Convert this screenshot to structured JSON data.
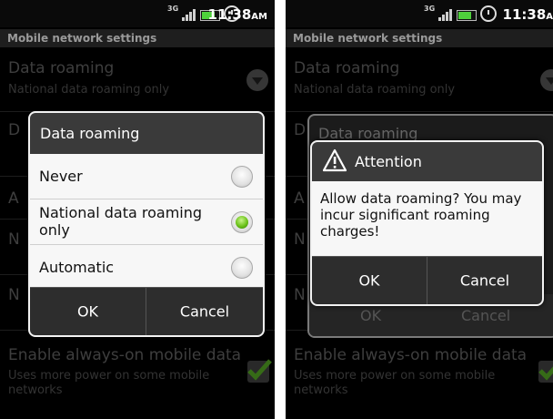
{
  "status_bar": {
    "network": "3G",
    "time": "11:38",
    "ampm": "AM"
  },
  "header": "Mobile network settings",
  "settings": {
    "data_roaming": {
      "title": "Data roaming",
      "summary": "National data roaming only"
    },
    "always_on": {
      "title": "Enable always-on mobile data",
      "summary": "Uses more power on some mobile networks",
      "checked": true
    },
    "row_letters": [
      "D",
      "A",
      "N",
      "N"
    ]
  },
  "left_dialog": {
    "title": "Data roaming",
    "options": [
      {
        "label": "Never",
        "selected": false
      },
      {
        "label": "National data roaming only",
        "selected": true
      },
      {
        "label": "Automatic",
        "selected": false
      }
    ],
    "ok": "OK",
    "cancel": "Cancel"
  },
  "right_dialog": {
    "background_title": "Data roaming",
    "title": "Attention",
    "message": "Allow data roaming? You may incur significant roaming charges!",
    "ok": "OK",
    "cancel": "Cancel"
  },
  "colors": {
    "accent_green": "#6cc21a",
    "dialog_bg": "#f7f7f7",
    "title_bar": "#3a3a3a"
  }
}
